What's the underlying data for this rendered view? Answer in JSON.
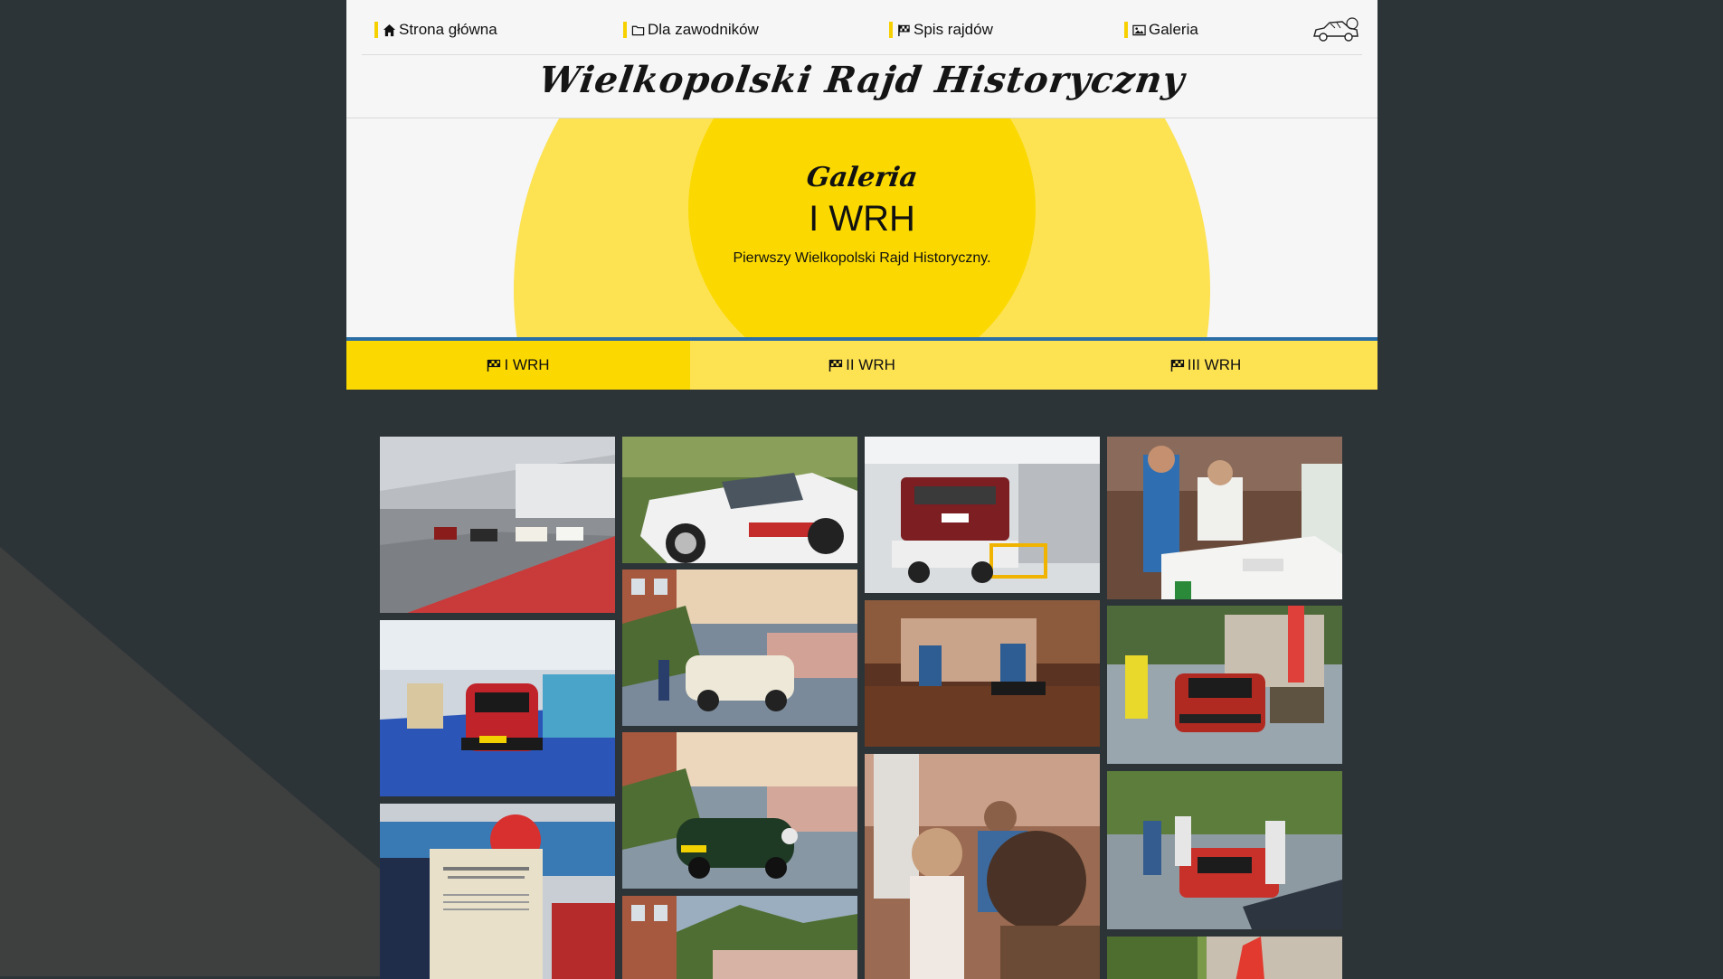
{
  "nav": {
    "items": [
      {
        "label": "Strona główna",
        "icon": "home-icon"
      },
      {
        "label": "Dla zawodników",
        "icon": "folder-icon"
      },
      {
        "label": "Spis rajdów",
        "icon": "flag-checkered-icon"
      },
      {
        "label": "Galeria",
        "icon": "image-icon"
      }
    ],
    "brand": "Wielkopolski Rajd Historyczny"
  },
  "hero": {
    "kicker": "Galeria",
    "title": "I WRH",
    "subtitle": "Pierwszy Wielkopolski Rajd Historyczny."
  },
  "tabs": [
    {
      "label": "I WRH",
      "active": true
    },
    {
      "label": "II WRH",
      "active": false
    },
    {
      "label": "III WRH",
      "active": false
    }
  ],
  "colors": {
    "accent": "#fbd900",
    "accent_light": "#fde252",
    "background": "#2d3438",
    "tab_border": "#2b6ea6"
  }
}
